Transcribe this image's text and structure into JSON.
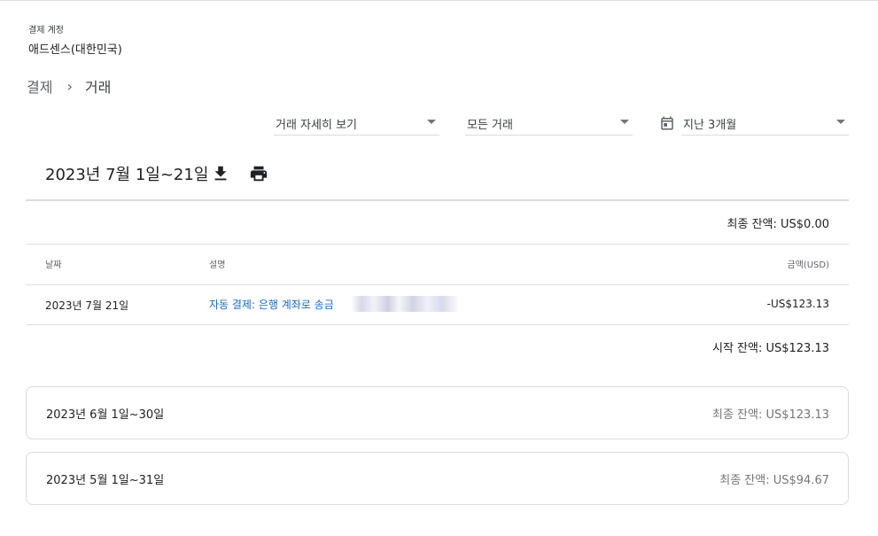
{
  "account": {
    "label": "결제 계정",
    "name": "애드센스(대한민국)"
  },
  "breadcrumb": {
    "parent": "결제",
    "separator": "›",
    "current": "거래"
  },
  "filters": {
    "detail": "거래 자세히 보기",
    "type": "모든 거래",
    "range": "지난 3개월"
  },
  "current_period": {
    "title": "2023년 7월 1일~21일",
    "final_balance": "최종 잔액: US$0.00",
    "columns": {
      "date": "날짜",
      "description": "설명",
      "amount": "금액(USD)"
    },
    "transactions": [
      {
        "date": "2023년 7월 21일",
        "description": "자동 결제: 은행 계좌로 송금",
        "amount": "-US$123.13"
      }
    ],
    "start_balance": "시작 잔액: US$123.13"
  },
  "previous_periods": [
    {
      "title": "2023년 6월 1일~30일",
      "final_balance": "최종 잔액: US$123.13"
    },
    {
      "title": "2023년 5월 1일~31일",
      "final_balance": "최종 잔액: US$94.67"
    }
  ],
  "colors": {
    "link": "#1967d2",
    "divider": "#dadce0",
    "muted": "#757575"
  }
}
